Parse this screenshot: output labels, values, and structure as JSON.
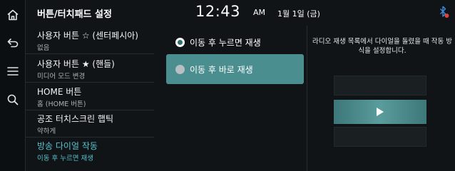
{
  "header": {
    "title": "버튼/터치패드 설정",
    "time": "12:43",
    "ampm": "AM",
    "date": "1월 1일 (금)"
  },
  "rail": {
    "icons": [
      "home-icon",
      "back-icon",
      "menu-icon",
      "search-icon"
    ]
  },
  "settings_list": [
    {
      "title": "사용자 버튼 ☆ (센터페시아)",
      "subtitle": "없음",
      "active": false
    },
    {
      "title": "사용자 버튼 ★ (핸들)",
      "subtitle": "미디어 모드 변경",
      "active": false
    },
    {
      "title": "HOME 버튼",
      "subtitle": "홈 (HOME 버튼)",
      "active": false
    },
    {
      "title": "공조 터치스크린 햅틱",
      "subtitle": "약하게",
      "active": false
    },
    {
      "title": "방송 다이얼 작동",
      "subtitle": "이동 후 누르면 재생",
      "active": true
    }
  ],
  "options": [
    {
      "label": "이동 후 누르면 재생",
      "checked": true
    },
    {
      "label": "이동 후 바로 재생",
      "checked": false
    }
  ],
  "description": "라디오 재생 목록에서 다이얼을 돌렸을 때 작동 방식을 설정합니다.",
  "colors": {
    "accent": "#58c3cf",
    "selected_option": "#4a8e8f",
    "background": "#101417"
  }
}
